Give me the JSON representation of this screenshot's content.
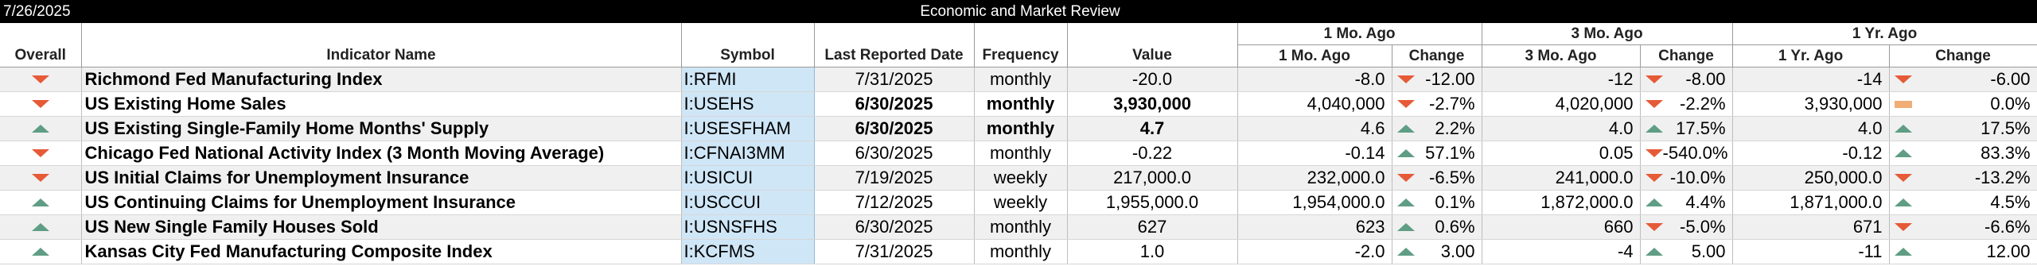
{
  "header": {
    "date": "7/26/2025",
    "title": "Economic and Market Review"
  },
  "groups": {
    "mo1": "1 Mo. Ago",
    "mo3": "3 Mo. Ago",
    "yr1": "1 Yr. Ago"
  },
  "columns": {
    "overall": "Overall",
    "indicator": "Indicator Name",
    "symbol": "Symbol",
    "last_date": "Last Reported Date",
    "frequency": "Frequency",
    "value": "Value",
    "mo1": "1 Mo. Ago",
    "mo1_change": "Change",
    "mo3": "3 Mo. Ago",
    "mo3_change": "Change",
    "yr1": "1 Yr. Ago",
    "yr1_change": "Change"
  },
  "status_colors": {
    "up": "#5f9d85",
    "down": "#e65a37",
    "flat": "#f0ad76"
  },
  "rows": [
    {
      "overall": "down",
      "name": "Richmond Fed Manufacturing Index",
      "symbol": "I:RFMI",
      "date": "7/31/2025",
      "freq": "monthly",
      "value": "-20.0",
      "mo1": "-8.0",
      "mo1_dir": "down",
      "mo1_chg": "-12.00",
      "mo3": "-12",
      "mo3_dir": "down",
      "mo3_chg": "-8.00",
      "yr1": "-14",
      "yr1_dir": "down",
      "yr1_chg": "-6.00",
      "bold": false
    },
    {
      "overall": "down",
      "name": "US Existing Home Sales",
      "symbol": "I:USEHS",
      "date": "6/30/2025",
      "freq": "monthly",
      "value": "3,930,000",
      "mo1": "4,040,000",
      "mo1_dir": "down",
      "mo1_chg": "-2.7%",
      "mo3": "4,020,000",
      "mo3_dir": "down",
      "mo3_chg": "-2.2%",
      "yr1": "3,930,000",
      "yr1_dir": "flat",
      "yr1_chg": "0.0%",
      "bold": true
    },
    {
      "overall": "up",
      "name": "US Existing Single-Family Home Months' Supply",
      "symbol": "I:USESFHAM",
      "date": "6/30/2025",
      "freq": "monthly",
      "value": "4.7",
      "mo1": "4.6",
      "mo1_dir": "up",
      "mo1_chg": "2.2%",
      "mo3": "4.0",
      "mo3_dir": "up",
      "mo3_chg": "17.5%",
      "yr1": "4.0",
      "yr1_dir": "up",
      "yr1_chg": "17.5%",
      "bold": true
    },
    {
      "overall": "down",
      "name": "Chicago Fed National Activity Index (3 Month Moving Average)",
      "symbol": "I:CFNAI3MM",
      "date": "6/30/2025",
      "freq": "monthly",
      "value": "-0.22",
      "mo1": "-0.14",
      "mo1_dir": "up",
      "mo1_chg": "57.1%",
      "mo3": "0.05",
      "mo3_dir": "down",
      "mo3_chg": "-540.0%",
      "yr1": "-0.12",
      "yr1_dir": "up",
      "yr1_chg": "83.3%",
      "bold": false
    },
    {
      "overall": "down",
      "name": "US Initial Claims for Unemployment Insurance",
      "symbol": "I:USICUI",
      "date": "7/19/2025",
      "freq": "weekly",
      "value": "217,000.0",
      "mo1": "232,000.0",
      "mo1_dir": "down",
      "mo1_chg": "-6.5%",
      "mo3": "241,000.0",
      "mo3_dir": "down",
      "mo3_chg": "-10.0%",
      "yr1": "250,000.0",
      "yr1_dir": "down",
      "yr1_chg": "-13.2%",
      "bold": false
    },
    {
      "overall": "up",
      "name": "US Continuing Claims for Unemployment Insurance",
      "symbol": "I:USCCUI",
      "date": "7/12/2025",
      "freq": "weekly",
      "value": "1,955,000.0",
      "mo1": "1,954,000.0",
      "mo1_dir": "up",
      "mo1_chg": "0.1%",
      "mo3": "1,872,000.0",
      "mo3_dir": "up",
      "mo3_chg": "4.4%",
      "yr1": "1,871,000.0",
      "yr1_dir": "up",
      "yr1_chg": "4.5%",
      "bold": false
    },
    {
      "overall": "up",
      "name": "US New Single Family Houses Sold",
      "symbol": "I:USNSFHS",
      "date": "6/30/2025",
      "freq": "monthly",
      "value": "627",
      "mo1": "623",
      "mo1_dir": "up",
      "mo1_chg": "0.6%",
      "mo3": "660",
      "mo3_dir": "down",
      "mo3_chg": "-5.0%",
      "yr1": "671",
      "yr1_dir": "down",
      "yr1_chg": "-6.6%",
      "bold": false
    },
    {
      "overall": "up",
      "name": "Kansas City Fed Manufacturing Composite Index",
      "symbol": "I:KCFMS",
      "date": "7/31/2025",
      "freq": "monthly",
      "value": "1.0",
      "mo1": "-2.0",
      "mo1_dir": "up",
      "mo1_chg": "3.00",
      "mo3": "-4",
      "mo3_dir": "up",
      "mo3_chg": "5.00",
      "yr1": "-11",
      "yr1_dir": "up",
      "yr1_chg": "12.00",
      "bold": false
    }
  ]
}
